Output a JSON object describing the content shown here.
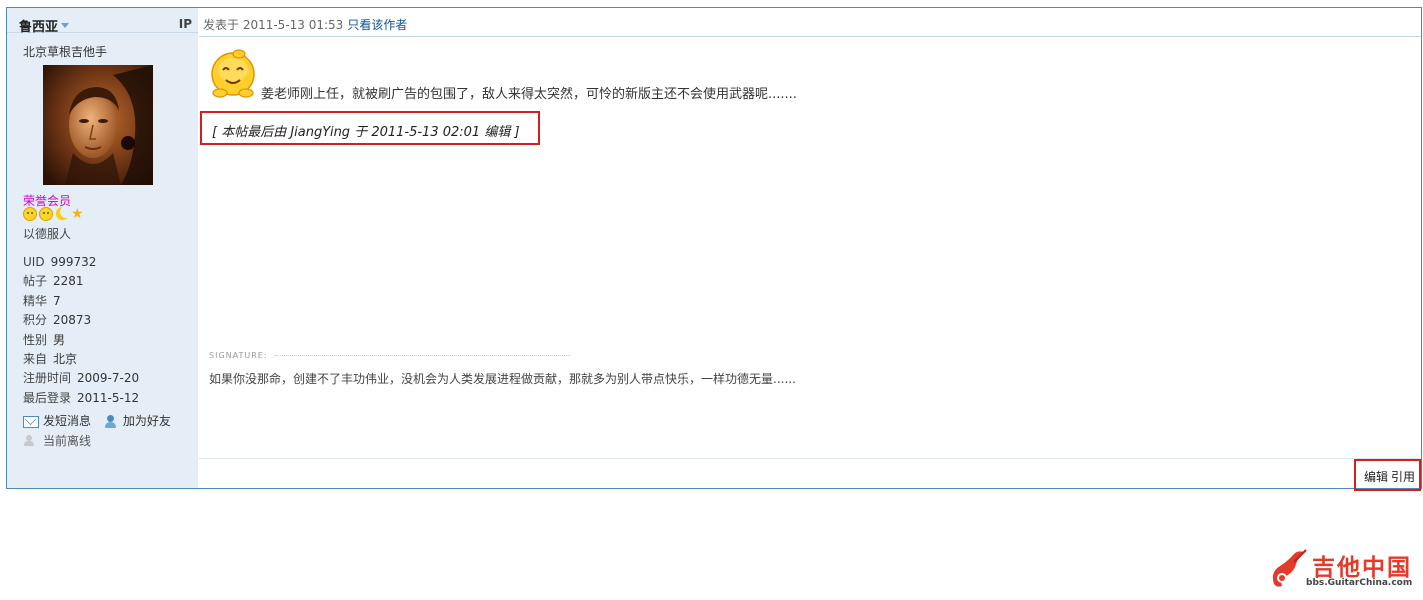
{
  "sidebar": {
    "username": "鲁西亚",
    "ip_label": "IP",
    "custom_title": "北京草根吉他手",
    "group": "荣誉会员",
    "motto": "以德服人",
    "stats": [
      {
        "label": "UID",
        "value": "999732"
      },
      {
        "label": "帖子",
        "value": "2281"
      },
      {
        "label": "精华",
        "value": "7"
      },
      {
        "label": "积分",
        "value": "20873"
      },
      {
        "label": "性别",
        "value": "男"
      },
      {
        "label": "来自",
        "value": "北京"
      },
      {
        "label": "注册时间",
        "value": "2009-7-20"
      },
      {
        "label": "最后登录",
        "value": "2011-5-12"
      }
    ],
    "actions": {
      "pm": "发短消息",
      "add_friend": "加为好友"
    },
    "online_status": "当前离线"
  },
  "post": {
    "posted_at": "发表于 2011-5-13 01:53",
    "author_only_link": "只看该作者",
    "message": "姜老师刚上任，就被刷广告的包围了，敌人来得太突然，可怜的新版主还不会使用武器呢.......",
    "edit_note": "[ 本帖最后由 JiangYing 于 2011-5-13 02:01 编辑 ]",
    "signature_label": "SIGNATURE:",
    "signature": "如果你没那命，创建不了丰功伟业，没机会为人类发展进程做贡献，那就多为别人带点快乐，一样功德无量......"
  },
  "post_ops": {
    "edit": "编辑",
    "quote": "引用"
  },
  "logo": {
    "main": "吉他中国",
    "sub": "bbs.GuitarChina.com"
  },
  "colors": {
    "border": "#4d8bb6",
    "sidebar_bg": "#e5eef7",
    "highlight_box": "#d21f1f",
    "group": "#cc00cc",
    "logo_red": "#e23b2c"
  }
}
